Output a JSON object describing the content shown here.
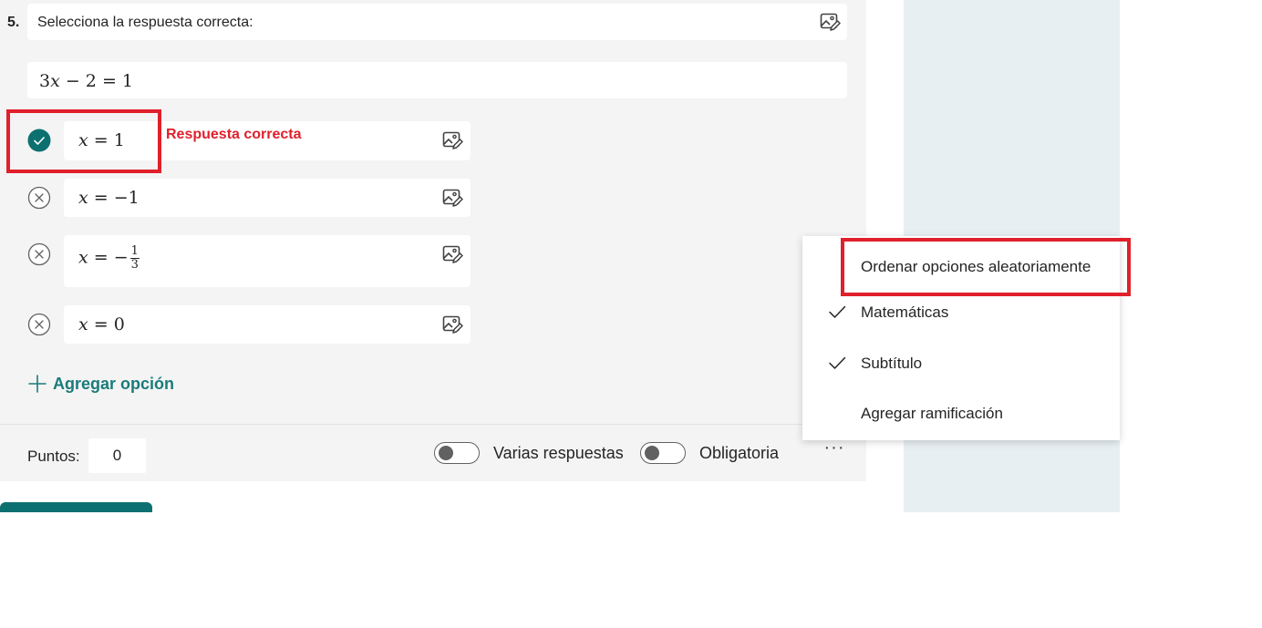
{
  "question": {
    "number": "5.",
    "title": "Selecciona la respuesta correcta:",
    "subtitle_math": "3x − 2 = 1"
  },
  "options": [
    {
      "math": "x = 1",
      "correct": true
    },
    {
      "math": "x = −1",
      "correct": false
    },
    {
      "math": "x = −1/3",
      "correct": false
    },
    {
      "math": "x = 0",
      "correct": false
    }
  ],
  "annotation": {
    "label": "Respuesta correcta",
    "color": "#e0202b"
  },
  "add_option_label": "Agregar opción",
  "footer": {
    "points_label": "Puntos:",
    "points_value": "0",
    "multiple_answers_label": "Varias respuestas",
    "required_label": "Obligatoria",
    "multiple_answers_on": false,
    "required_on": false,
    "more_label": "···"
  },
  "menu": {
    "items": [
      {
        "label": "Ordenar opciones aleatoriamente",
        "checked": false
      },
      {
        "label": "Matemáticas",
        "checked": true
      },
      {
        "label": "Subtítulo",
        "checked": true
      },
      {
        "label": "Agregar ramificación",
        "checked": false
      }
    ]
  },
  "colors": {
    "accent": "#1a7b7b",
    "correct_fill": "#0d7070",
    "highlight": "#e0202b",
    "card_bg": "#f4f4f4",
    "panel_bg": "#e7eff2"
  }
}
